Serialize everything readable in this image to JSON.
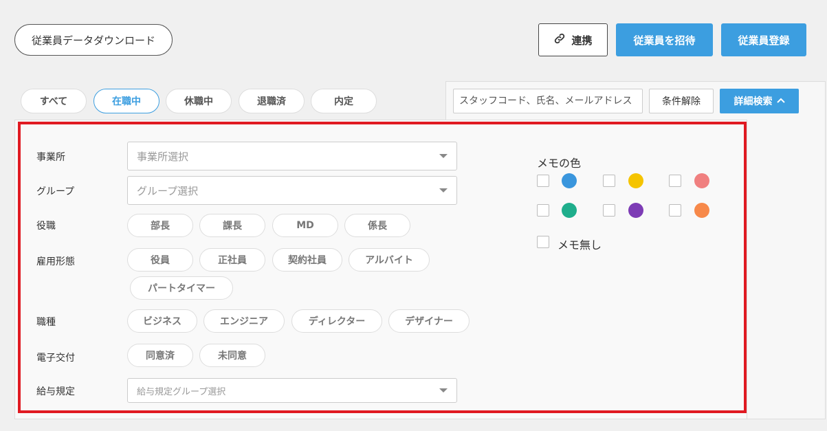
{
  "header": {
    "download_label": "従業員データダウンロード",
    "link_label": "連携",
    "invite_label": "従業員を招待",
    "register_label": "従業員登録"
  },
  "status_tabs": [
    {
      "label": "すべて",
      "active": false
    },
    {
      "label": "在職中",
      "active": true
    },
    {
      "label": "休職中",
      "active": false
    },
    {
      "label": "退職済",
      "active": false
    },
    {
      "label": "内定",
      "active": false
    }
  ],
  "search": {
    "placeholder": "スタッフコード、氏名、メールアドレス",
    "clear_label": "条件解除",
    "detail_label": "詳細検索"
  },
  "filters": {
    "office": {
      "label": "事業所",
      "placeholder": "事業所選択"
    },
    "group": {
      "label": "グループ",
      "placeholder": "グループ選択"
    },
    "position": {
      "label": "役職",
      "options": [
        "部長",
        "課長",
        "MD",
        "係長"
      ]
    },
    "employment": {
      "label": "雇用形態",
      "options": [
        "役員",
        "正社員",
        "契約社員",
        "アルバイト",
        "パートタイマー"
      ]
    },
    "job_type": {
      "label": "職種",
      "options": [
        "ビジネス",
        "エンジニア",
        "ディレクター",
        "デザイナー"
      ]
    },
    "e_delivery": {
      "label": "電子交付",
      "options": [
        "同意済",
        "未同意"
      ]
    },
    "payroll": {
      "label": "給与規定",
      "placeholder": "給与規定グループ選択"
    }
  },
  "memo": {
    "title": "メモの色",
    "colors": [
      "#3a96dd",
      "#f5c400",
      "#f08080",
      "#1fae8c",
      "#7d3cb5",
      "#f7894a"
    ],
    "none_label": "メモ無し"
  }
}
